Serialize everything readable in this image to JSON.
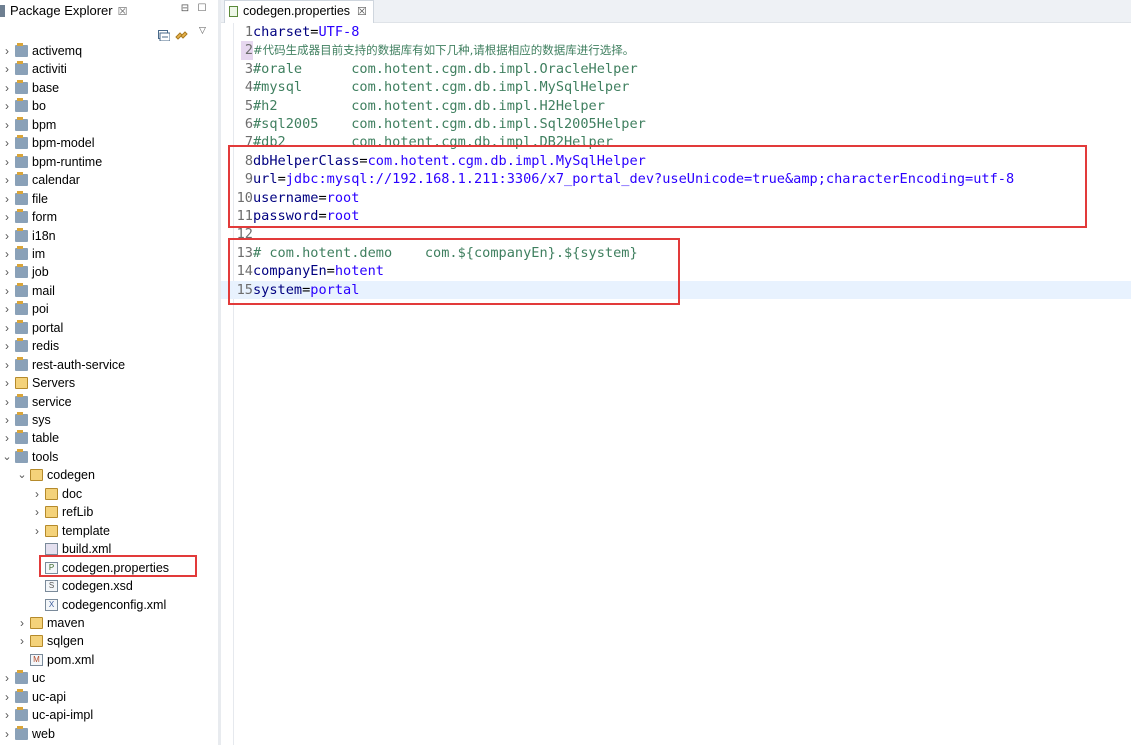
{
  "explorer": {
    "title": "Package Explorer",
    "close_glyph": "☒",
    "minimize_glyph": "⊟",
    "maximize_glyph": "☐",
    "items": [
      {
        "label": "activemq",
        "level": 0,
        "type": "project",
        "expanded": false
      },
      {
        "label": "activiti",
        "level": 0,
        "type": "project",
        "expanded": false
      },
      {
        "label": "base",
        "level": 0,
        "type": "project",
        "expanded": false
      },
      {
        "label": "bo",
        "level": 0,
        "type": "project",
        "expanded": false
      },
      {
        "label": "bpm",
        "level": 0,
        "type": "project",
        "expanded": false
      },
      {
        "label": "bpm-model",
        "level": 0,
        "type": "project",
        "expanded": false
      },
      {
        "label": "bpm-runtime",
        "level": 0,
        "type": "project",
        "expanded": false
      },
      {
        "label": "calendar",
        "level": 0,
        "type": "project",
        "expanded": false
      },
      {
        "label": "file",
        "level": 0,
        "type": "project",
        "expanded": false
      },
      {
        "label": "form",
        "level": 0,
        "type": "project",
        "expanded": false
      },
      {
        "label": "i18n",
        "level": 0,
        "type": "project",
        "expanded": false
      },
      {
        "label": "im",
        "level": 0,
        "type": "project",
        "expanded": false
      },
      {
        "label": "job",
        "level": 0,
        "type": "project",
        "expanded": false
      },
      {
        "label": "mail",
        "level": 0,
        "type": "project",
        "expanded": false
      },
      {
        "label": "poi",
        "level": 0,
        "type": "project",
        "expanded": false
      },
      {
        "label": "portal",
        "level": 0,
        "type": "project",
        "expanded": false
      },
      {
        "label": "redis",
        "level": 0,
        "type": "project",
        "expanded": false
      },
      {
        "label": "rest-auth-service",
        "level": 0,
        "type": "project",
        "expanded": false
      },
      {
        "label": "Servers",
        "level": 0,
        "type": "folder",
        "expanded": false
      },
      {
        "label": "service",
        "level": 0,
        "type": "project",
        "expanded": false
      },
      {
        "label": "sys",
        "level": 0,
        "type": "project",
        "expanded": false
      },
      {
        "label": "table",
        "level": 0,
        "type": "project",
        "expanded": false
      },
      {
        "label": "tools",
        "level": 0,
        "type": "project",
        "expanded": true
      },
      {
        "label": "codegen",
        "level": 1,
        "type": "folder",
        "expanded": true
      },
      {
        "label": "doc",
        "level": 2,
        "type": "folder",
        "expanded": false
      },
      {
        "label": "refLib",
        "level": 2,
        "type": "folder",
        "expanded": false
      },
      {
        "label": "template",
        "level": 2,
        "type": "folder",
        "expanded": false
      },
      {
        "label": "build.xml",
        "level": 2,
        "type": "ant",
        "expanded": null
      },
      {
        "label": "codegen.properties",
        "level": 2,
        "type": "properties",
        "expanded": null,
        "highlighted": true
      },
      {
        "label": "codegen.xsd",
        "level": 2,
        "type": "xsd",
        "expanded": null
      },
      {
        "label": "codegenconfig.xml",
        "level": 2,
        "type": "xml",
        "expanded": null
      },
      {
        "label": "maven",
        "level": 1,
        "type": "folder",
        "expanded": false
      },
      {
        "label": "sqlgen",
        "level": 1,
        "type": "folder",
        "expanded": false
      },
      {
        "label": "pom.xml",
        "level": 1,
        "type": "pom",
        "expanded": null
      },
      {
        "label": "uc",
        "level": 0,
        "type": "project",
        "expanded": false
      },
      {
        "label": "uc-api",
        "level": 0,
        "type": "project",
        "expanded": false
      },
      {
        "label": "uc-api-impl",
        "level": 0,
        "type": "project",
        "expanded": false
      },
      {
        "label": "web",
        "level": 0,
        "type": "project",
        "expanded": false
      }
    ]
  },
  "editor": {
    "tab_label": "codegen.properties",
    "close_glyph": "☒",
    "current_line": 15,
    "marked_line": 2,
    "lines": [
      {
        "n": "1",
        "key": "charset",
        "sep": "=",
        "value": "UTF-8",
        "comment": ""
      },
      {
        "n": "2",
        "key": "",
        "sep": "",
        "value": "",
        "comment": "#代码生成器目前支持的数据库有如下几种,请根据相应的数据库进行选择。",
        "cjk": true
      },
      {
        "n": "3",
        "key": "",
        "sep": "",
        "value": "",
        "comment": "#orale      com.hotent.cgm.db.impl.OracleHelper"
      },
      {
        "n": "4",
        "key": "",
        "sep": "",
        "value": "",
        "comment": "#mysql      com.hotent.cgm.db.impl.MySqlHelper"
      },
      {
        "n": "5",
        "key": "",
        "sep": "",
        "value": "",
        "comment": "#h2         com.hotent.cgm.db.impl.H2Helper"
      },
      {
        "n": "6",
        "key": "",
        "sep": "",
        "value": "",
        "comment": "#sql2005    com.hotent.cgm.db.impl.Sql2005Helper"
      },
      {
        "n": "7",
        "key": "",
        "sep": "",
        "value": "",
        "comment": "#db2        com.hotent.cgm.db.impl.DB2Helper"
      },
      {
        "n": "8",
        "key": "dbHelperClass",
        "sep": "=",
        "value": "com.hotent.cgm.db.impl.MySqlHelper",
        "comment": ""
      },
      {
        "n": "9",
        "key": "url",
        "sep": "=",
        "value": "jdbc:mysql://192.168.1.211:3306/x7_portal_dev?useUnicode=true&amp;characterEncoding=utf-8",
        "comment": ""
      },
      {
        "n": "10",
        "key": "username",
        "sep": "=",
        "value": "root",
        "comment": ""
      },
      {
        "n": "11",
        "key": "password",
        "sep": "=",
        "value": "root",
        "comment": ""
      },
      {
        "n": "12",
        "key": "",
        "sep": "",
        "value": "",
        "comment": ""
      },
      {
        "n": "13",
        "key": "",
        "sep": "",
        "value": "",
        "comment": "# com.hotent.demo    com.${companyEn}.${system}"
      },
      {
        "n": "14",
        "key": "companyEn",
        "sep": "=",
        "value": "hotent",
        "comment": ""
      },
      {
        "n": "15",
        "key": "system",
        "sep": "=",
        "value": "portal",
        "comment": ""
      }
    ]
  },
  "colors": {
    "key": "#000080",
    "value": "#2a00ff",
    "comment": "#3f7f5f",
    "highlight_border": "#e23a3a",
    "current_line_bg": "#e8f2fe"
  }
}
